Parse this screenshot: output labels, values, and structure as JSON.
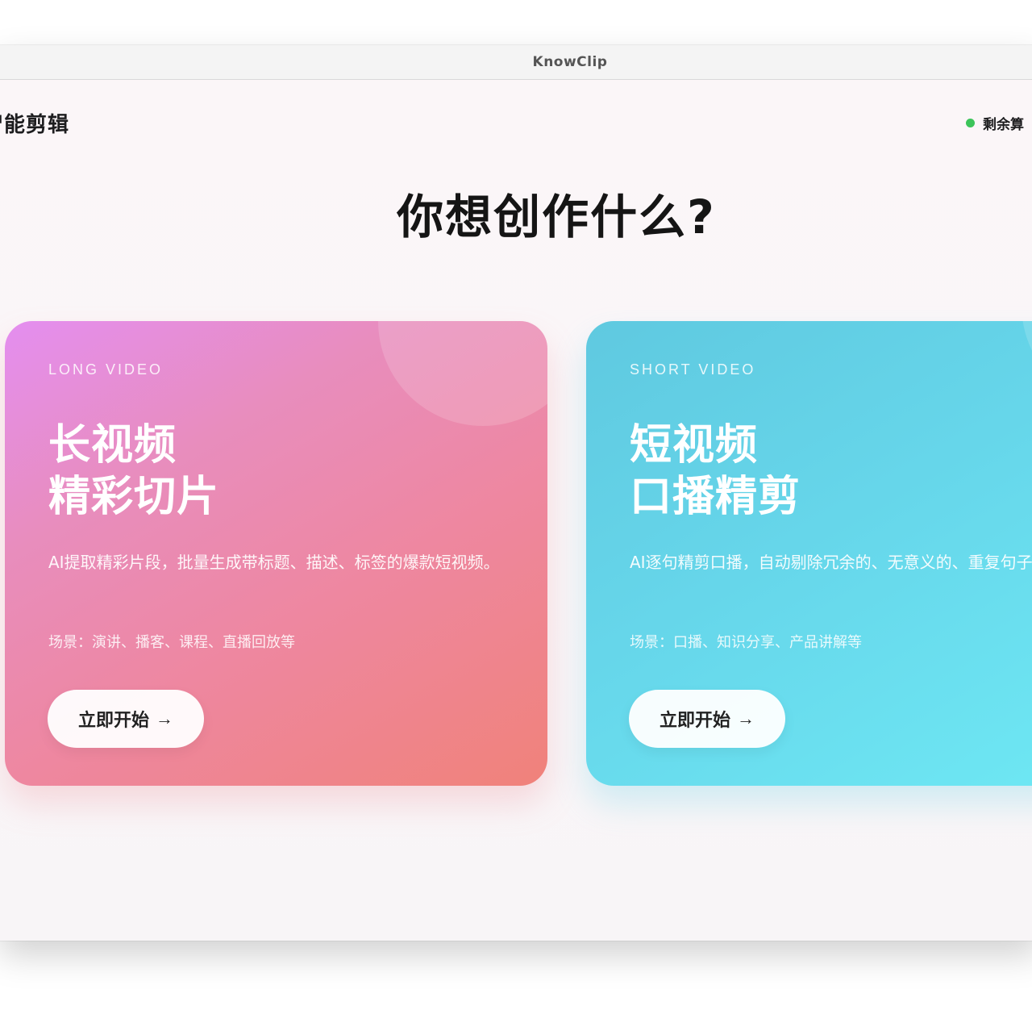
{
  "window": {
    "title": "KnowClip"
  },
  "header": {
    "brand": "智能剪辑",
    "credits_label": "剩余算"
  },
  "main": {
    "headline": "你想创作什么?",
    "cards": [
      {
        "eyebrow": "LONG VIDEO",
        "title_line1": "长视频",
        "title_line2": "精彩切片",
        "description": "AI提取精彩片段，批量生成带标题、描述、标签的爆款短视频。",
        "scene": "场景：演讲、播客、课程、直播回放等",
        "button_label": "立即开始",
        "button_arrow": "→"
      },
      {
        "eyebrow": "SHORT VIDEO",
        "title_line1": "短视频",
        "title_line2": "口播精剪",
        "description": "AI逐句精剪口播，自动剔除冗余的、无意义的、重复句子。",
        "scene": "场景：口播、知识分享、产品讲解等",
        "button_label": "立即开始",
        "button_arrow": "→"
      }
    ]
  },
  "colors": {
    "status_dot": "#3cc45a",
    "long_card_start": "#e48ef0",
    "long_card_end": "#f0827a",
    "short_card_start": "#5fc9e0",
    "short_card_end": "#6ee8f4"
  }
}
